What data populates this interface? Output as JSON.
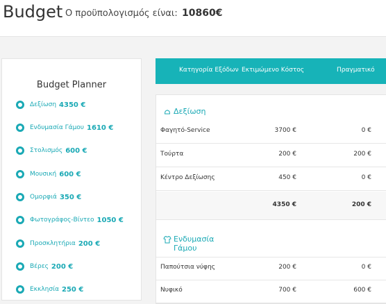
{
  "header": {
    "title": "Budget",
    "subtitle": "Ο προϋπολογισμός είναι:",
    "amount": "10860€"
  },
  "sidebar": {
    "title": "Budget Planner",
    "items": [
      {
        "name": "Δεξίωση",
        "value": "4350 €"
      },
      {
        "name": "Ενδυμασία Γάμου",
        "value": "1610 €"
      },
      {
        "name": "Στολισμός",
        "value": "600 €"
      },
      {
        "name": "Μουσική",
        "value": "600 €"
      },
      {
        "name": "Ομορφιά",
        "value": "350 €"
      },
      {
        "name": "Φωτογράφος-Βίντεο",
        "value": "1050 €"
      },
      {
        "name": "Προσκλητήρια",
        "value": "200 €"
      },
      {
        "name": "Βέρες",
        "value": "200 €"
      },
      {
        "name": "Εκκλησία",
        "value": "250 €"
      }
    ]
  },
  "table": {
    "headers": [
      "Κατηγορία Εξόδων",
      "Εκτιμώμενο Κόστος",
      "Πραγματικό"
    ],
    "section1": {
      "title": "Δεξίωση",
      "icon": "bell-icon",
      "rows": [
        {
          "category": "Φαγητό-Service",
          "estimated": "3700 €",
          "actual": "0 €"
        },
        {
          "category": "Τούρτα",
          "estimated": "200 €",
          "actual": "200 €"
        },
        {
          "category": "Κέντρο Δεξίωσης",
          "estimated": "450 €",
          "actual": "0 €"
        }
      ],
      "total_estimated": "4350 €",
      "total_actual": "200 €"
    },
    "section2": {
      "title_line1": "Ενδυμασία",
      "title_line2": "Γάμου",
      "icon": "shirt-icon",
      "rows": [
        {
          "category": "Παπούτσια νύφης",
          "estimated": "200 €",
          "actual": "0 €"
        },
        {
          "category": "Νυφικό",
          "estimated": "700 €",
          "actual": "600 €"
        }
      ]
    }
  },
  "colors": {
    "accent": "#17b3b8"
  }
}
